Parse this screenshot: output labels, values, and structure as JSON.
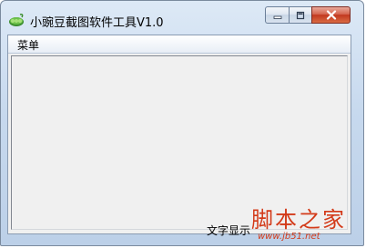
{
  "window": {
    "title": "小豌豆截图软件工具V1.0"
  },
  "titlebar_buttons": {
    "minimize": "minimize-icon",
    "maximize": "maximize-icon",
    "close": "close-icon"
  },
  "menu": {
    "items": [
      {
        "label": "菜单"
      }
    ]
  },
  "status": {
    "text": "文字显示"
  },
  "watermark": {
    "logo": "脚本之家",
    "url": "www.jb51.net"
  },
  "colors": {
    "close_button": "#c2381f",
    "watermark": "#d33a19"
  }
}
